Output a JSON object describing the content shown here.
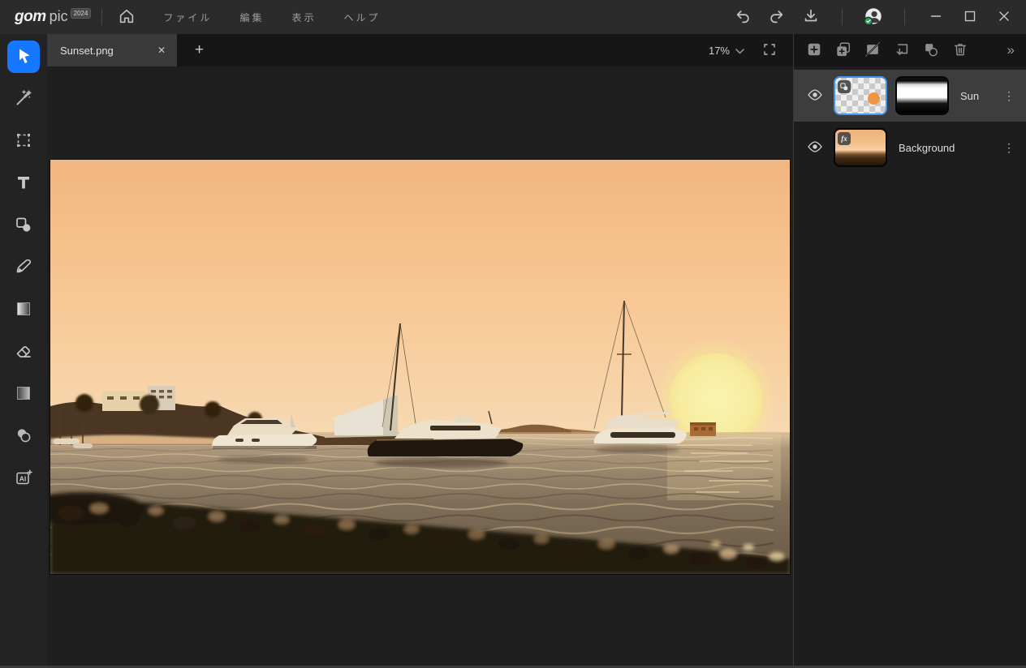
{
  "titlebar": {
    "logo_gom": "gom",
    "logo_pic": "pic",
    "logo_badge": "2024",
    "menus": [
      {
        "label": "ファイル"
      },
      {
        "label": "編集"
      },
      {
        "label": "表示"
      },
      {
        "label": "ヘルプ"
      }
    ],
    "window_icons": [
      "undo-icon",
      "redo-icon",
      "download-icon",
      "account-avatar",
      "minimize-icon",
      "maximize-icon",
      "close-icon"
    ]
  },
  "tabs": [
    {
      "title": "Sunset.png",
      "active": true
    }
  ],
  "canvas": {
    "zoom_level": "17%",
    "scene_colors": {
      "sky_top": "#f2b87f",
      "sky_horizon": "#f6d7ae",
      "sun": "#f8ec9f",
      "sea_light": "#d9c09c",
      "sea_dark": "#6a5a45",
      "land_silhouette": "#4a3622",
      "pebbles": "#221a11"
    }
  },
  "tools": [
    {
      "name": "select",
      "icon": "cursor-icon",
      "active": true
    },
    {
      "name": "magic-wand",
      "icon": "magic-wand-icon",
      "active": false
    },
    {
      "name": "transform",
      "icon": "transform-icon",
      "active": false
    },
    {
      "name": "text",
      "icon": "text-icon",
      "active": false
    },
    {
      "name": "shape",
      "icon": "shape-icon",
      "active": false
    },
    {
      "name": "brush",
      "icon": "brush-icon",
      "active": false
    },
    {
      "name": "gradient",
      "icon": "gradient-icon",
      "active": false
    },
    {
      "name": "eraser",
      "icon": "eraser-icon",
      "active": false
    },
    {
      "name": "adjust",
      "icon": "adjust-gradient-icon",
      "active": false
    },
    {
      "name": "blend",
      "icon": "blend-circles-icon",
      "active": false
    },
    {
      "name": "ai-tools",
      "icon": "ai-icon",
      "active": false
    }
  ],
  "layer_toolbar": [
    {
      "name": "add-layer"
    },
    {
      "name": "duplicate-layer"
    },
    {
      "name": "disable-layer"
    },
    {
      "name": "merge-layer"
    },
    {
      "name": "merge-shapes"
    },
    {
      "name": "delete-layer"
    },
    {
      "name": "collapse-panel"
    }
  ],
  "layers_panel": {
    "rows": [
      {
        "name": "Sun",
        "selected": true,
        "visible": true,
        "has_mask": true,
        "thumb_badge": "shape"
      },
      {
        "name": "Background",
        "selected": false,
        "visible": true,
        "has_mask": false,
        "effects_badge": "fx"
      }
    ]
  },
  "glyphs": {
    "close": "✕",
    "plus": "+",
    "kebab": "⋮",
    "chevron_double": "»"
  },
  "colors": {
    "accent_blue": "#1677ff",
    "selection_border": "#4096ee",
    "sun_layer_dot": "#ef9440",
    "selected_row_bg": "#3d3d3d",
    "avatar_check_green": "#21a356"
  }
}
